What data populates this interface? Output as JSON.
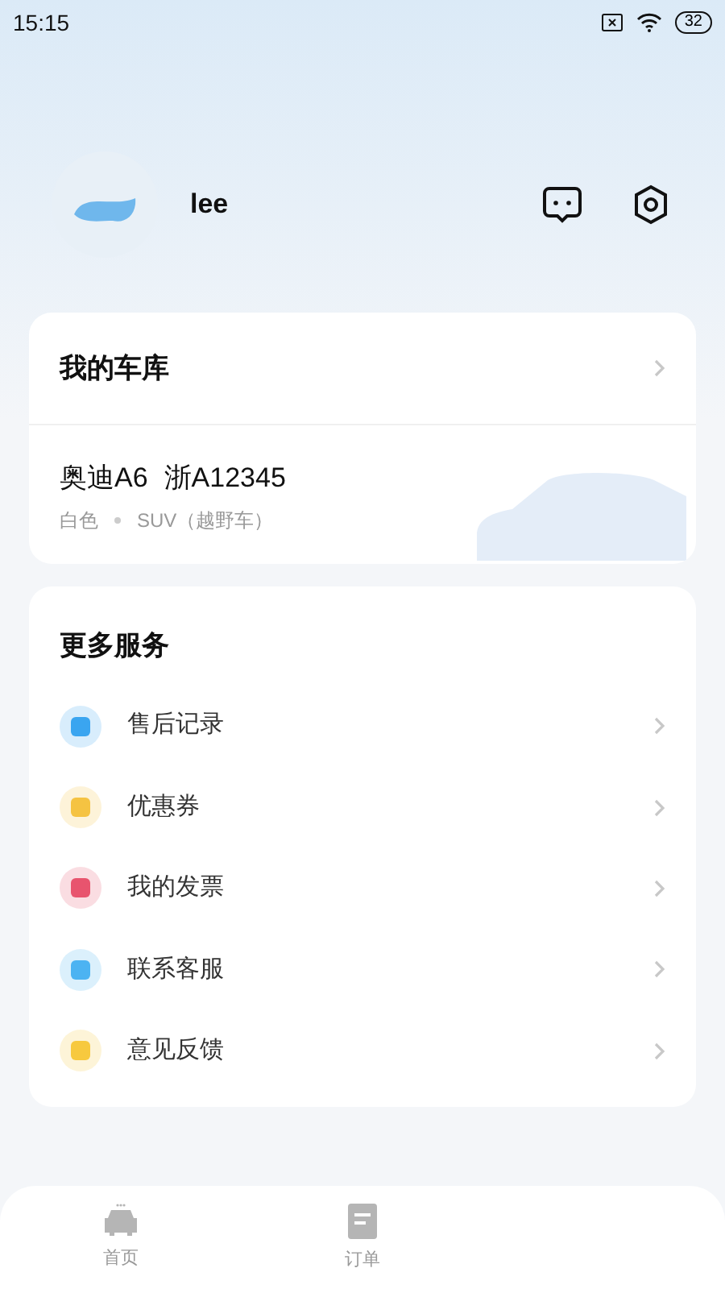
{
  "status_bar": {
    "time": "15:15",
    "battery": "32"
  },
  "profile": {
    "username": "lee"
  },
  "garage": {
    "title": "我的车库",
    "car_name": "奥迪A6",
    "plate": "浙A12345",
    "car_color": "白色",
    "type": "SUV（越野车）"
  },
  "services": {
    "title": "更多服务",
    "items": [
      {
        "label": "售后记录",
        "color": "#3aa5f0"
      },
      {
        "label": "优惠券",
        "color": "#f5c342"
      },
      {
        "label": "我的发票",
        "color": "#e8546e"
      },
      {
        "label": "联系客服",
        "color": "#4cb3f2"
      },
      {
        "label": "意见反馈",
        "color": "#f7c93e"
      }
    ]
  },
  "tab_bar": [
    {
      "label": "首页",
      "selected": false,
      "kind": "car"
    },
    {
      "label": "订单",
      "selected": false,
      "kind": "doc"
    }
  ]
}
